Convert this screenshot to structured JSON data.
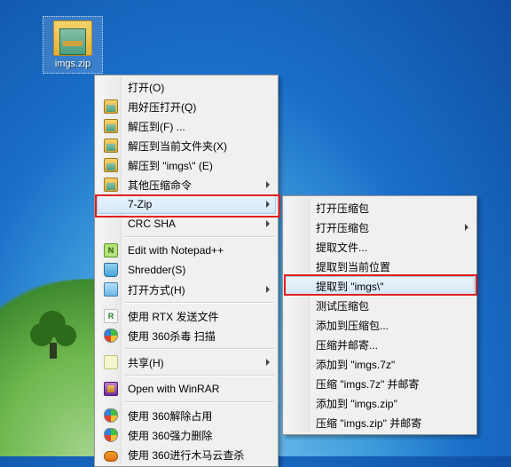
{
  "desktop": {
    "icon_label": "imgs.zip"
  },
  "menu": {
    "open": "打开(O)",
    "open_haozip": "用好压打开(Q)",
    "extract_to": "解压到(F) ...",
    "extract_here": "解压到当前文件夹(X)",
    "extract_named": "解压到 \"imgs\\\" (E)",
    "other_compress": "其他压缩命令",
    "seven_zip": "7-Zip",
    "crc_sha": "CRC SHA",
    "edit_npp": "Edit with Notepad++",
    "shredder": "Shredder(S)",
    "open_with": "打开方式(H)",
    "rtx_send": "使用 RTX 发送文件",
    "scan_360": "使用 360杀毒 扫描",
    "share": "共享(H)",
    "open_winrar": "Open with WinRAR",
    "unlock_360": "使用 360解除占用",
    "delete_360": "使用 360强力删除",
    "trojan_360": "使用 360进行木马云查杀"
  },
  "submenu": {
    "open_archive": "打开压缩包",
    "open_archive_sub": "打开压缩包",
    "extract_files": "提取文件...",
    "extract_here": "提取到当前位置",
    "extract_named": "提取到 \"imgs\\\"",
    "test_archive": "测试压缩包",
    "add_archive": "添加到压缩包...",
    "compress_mail": "压缩并邮寄...",
    "add_7z": "添加到 \"imgs.7z\"",
    "compress_7z_mail": "压缩 \"imgs.7z\" 并邮寄",
    "add_zip": "添加到 \"imgs.zip\"",
    "compress_zip_mail": "压缩 \"imgs.zip\" 并邮寄"
  }
}
